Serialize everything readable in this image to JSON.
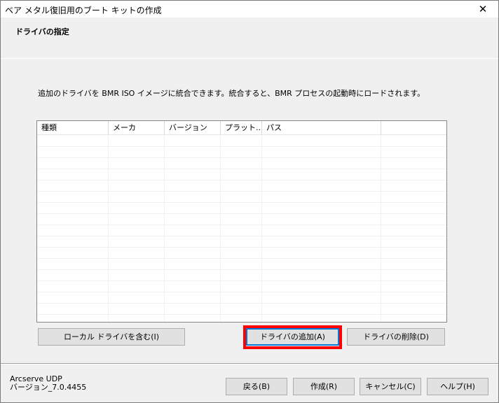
{
  "window": {
    "title": "ベア メタル復旧用のブート キットの作成",
    "close_glyph": "✕"
  },
  "step": {
    "title": "ドライバの指定"
  },
  "instruction": "追加のドライバを BMR ISO イメージに統合できます。統合すると、BMR プロセスの起動時にロードされます。",
  "driver_list": {
    "columns": [
      "種類",
      "メーカ",
      "バージョン",
      "プラット...",
      "パス",
      ""
    ],
    "rows": []
  },
  "buttons": {
    "include_local": "ローカル ドライバを含む(I)",
    "add_driver": "ドライバの追加(A)",
    "delete_driver": "ドライバの削除(D)",
    "back": "戻る(B)",
    "create": "作成(R)",
    "cancel": "キャンセル(C)",
    "help": "ヘルプ(H)"
  },
  "product": {
    "name": "Arcserve UDP",
    "version": "バージョン_7.0.4455"
  },
  "colors": {
    "highlight": "#ff0000",
    "focus": "#0078d7"
  }
}
